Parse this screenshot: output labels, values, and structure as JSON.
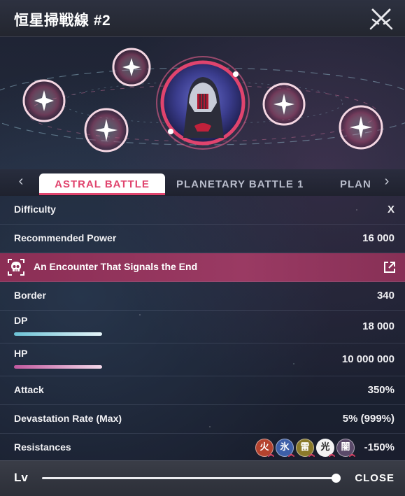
{
  "header": {
    "title": "恒星掃戦線 #2"
  },
  "tabs": {
    "items": [
      {
        "label": "ASTRAL BATTLE",
        "active": true
      },
      {
        "label": "PLANETARY BATTLE 1",
        "active": false
      },
      {
        "label": "PLAN",
        "active": false
      }
    ]
  },
  "stats": {
    "difficulty": {
      "label": "Difficulty",
      "value": "X"
    },
    "recommended_power": {
      "label": "Recommended Power",
      "value": "16 000"
    },
    "border": {
      "label": "Border",
      "value": "340"
    },
    "dp": {
      "label": "DP",
      "value": "18 000"
    },
    "hp": {
      "label": "HP",
      "value": "10 000 000"
    },
    "attack": {
      "label": "Attack",
      "value": "350%"
    },
    "devastation": {
      "label": "Devastation Rate (Max)",
      "value": "5% (999%)"
    },
    "resistances": {
      "label": "Resistances",
      "value": "-150%",
      "icons": [
        {
          "glyph": "火",
          "color": "#b5432f"
        },
        {
          "glyph": "氷",
          "color": "#3d5fa8"
        },
        {
          "glyph": "雷",
          "color": "#8a7a2a"
        },
        {
          "glyph": "光",
          "color": "#f2f2f2"
        },
        {
          "glyph": "闇",
          "color": "#5a4a6a"
        }
      ]
    }
  },
  "encounter": {
    "title": "An Encounter That Signals the End"
  },
  "footer": {
    "lv_label": "Lv",
    "close_label": "CLOSE",
    "level_fraction": 1.0
  },
  "colors": {
    "accent": "#e0446e",
    "encounter_bg": "#8b2e55"
  }
}
